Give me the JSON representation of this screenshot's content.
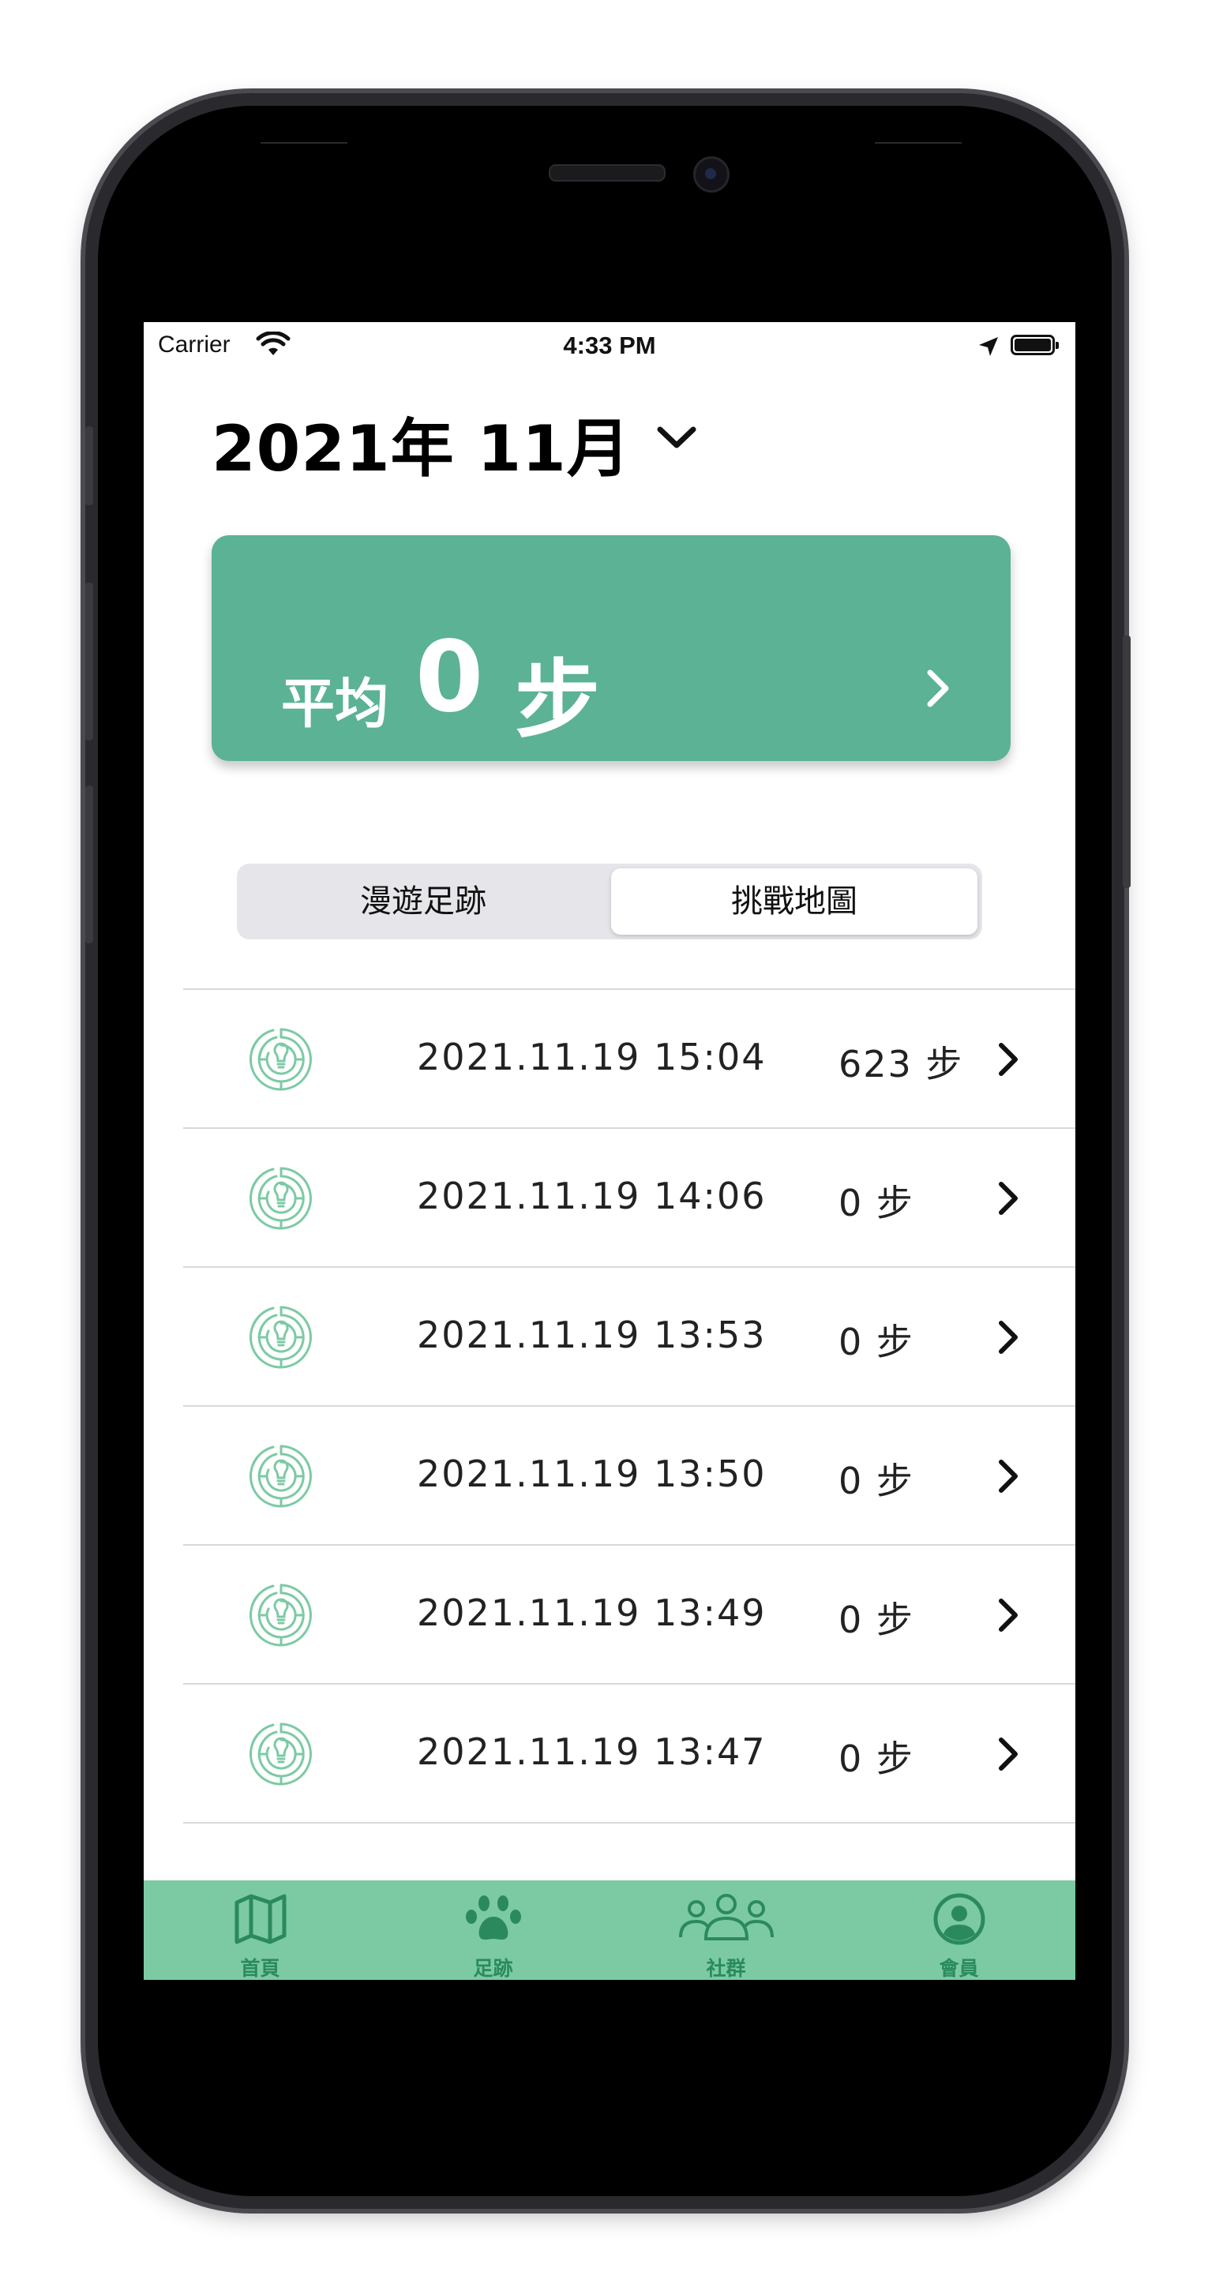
{
  "status_bar": {
    "carrier": "Carrier",
    "time": "4:33 PM"
  },
  "header": {
    "month_title": "2021年 11月"
  },
  "summary": {
    "label": "平均",
    "value": "0",
    "unit": "步"
  },
  "segment": {
    "items": [
      "漫遊足跡",
      "挑戰地圖"
    ],
    "selected": "挑戰地圖"
  },
  "records": [
    {
      "datetime": "2021.11.19 15:04",
      "steps": "623 步"
    },
    {
      "datetime": "2021.11.19 14:06",
      "steps": "0 步"
    },
    {
      "datetime": "2021.11.19 13:53",
      "steps": "0 步"
    },
    {
      "datetime": "2021.11.19 13:50",
      "steps": "0 步"
    },
    {
      "datetime": "2021.11.19 13:49",
      "steps": "0 步"
    },
    {
      "datetime": "2021.11.19 13:47",
      "steps": "0 步"
    }
  ],
  "tabbar": {
    "items": [
      {
        "label": "首頁",
        "icon": "map-icon"
      },
      {
        "label": "足跡",
        "icon": "paw-icon"
      },
      {
        "label": "社群",
        "icon": "group-icon"
      },
      {
        "label": "會員",
        "icon": "profile-icon"
      }
    ],
    "selected": "足跡"
  },
  "colors": {
    "card": "#5bb295",
    "tabbar": "#7ccaa3",
    "tab_icon": "#2a8a5e",
    "row_icon": "#7ccaa3"
  }
}
